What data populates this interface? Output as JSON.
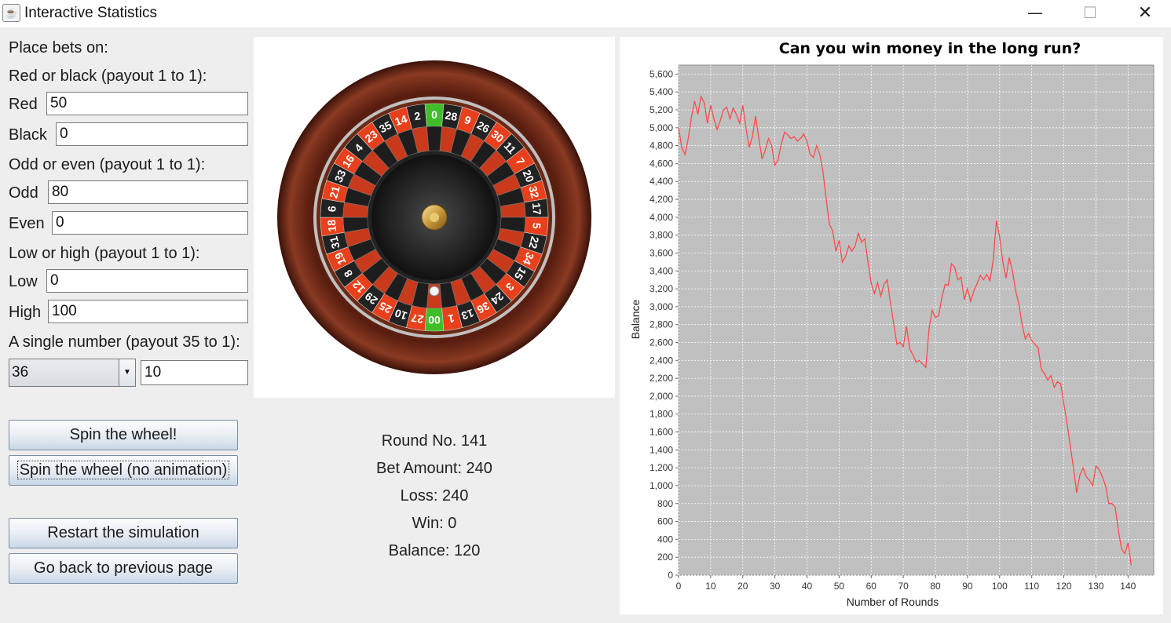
{
  "window": {
    "title": "Interactive Statistics",
    "min_glyph": "—",
    "max_glyph": "☐",
    "close_glyph": "✕"
  },
  "bets": {
    "header": "Place bets on:",
    "red_black_label": "Red or black (payout 1 to 1):",
    "red_label": "Red",
    "red_value": "50",
    "black_label": "Black",
    "black_value": "0",
    "odd_even_label": "Odd or even (payout 1 to 1):",
    "odd_label": "Odd",
    "odd_value": "80",
    "even_label": "Even",
    "even_value": "0",
    "low_high_label": "Low or high (payout 1 to 1):",
    "low_label": "Low",
    "low_value": "0",
    "high_label": "High",
    "high_value": "100",
    "single_label": "A single number (payout 35 to 1):",
    "single_number": "36",
    "single_value": "10"
  },
  "buttons": {
    "spin": "Spin the wheel!",
    "spin_no_anim": "Spin the wheel (no animation)",
    "restart": "Restart the simulation",
    "back": "Go back to previous page"
  },
  "wheel": {
    "numbers": [
      "0",
      "28",
      "9",
      "26",
      "30",
      "11",
      "7",
      "20",
      "32",
      "17",
      "5",
      "22",
      "34",
      "15",
      "3",
      "24",
      "36",
      "13",
      "1",
      "00",
      "27",
      "10",
      "25",
      "29",
      "12",
      "8",
      "19",
      "31",
      "18",
      "6",
      "21",
      "33",
      "16",
      "4",
      "23",
      "35",
      "14",
      "2"
    ],
    "colors": {
      "red": "#e8401c",
      "black": "#222222",
      "green": "#3fbe2a"
    }
  },
  "stats": {
    "round": "Round No. 141",
    "bet": "Bet Amount: 240",
    "loss": "Loss: 240",
    "win": "Win: 0",
    "balance": "Balance: 120"
  },
  "chart_data": {
    "type": "line",
    "title": "Can you win money in the long run?",
    "xlabel": "Number of Rounds",
    "ylabel": "Balance",
    "xlim": [
      0,
      148
    ],
    "ylim": [
      0,
      5700
    ],
    "xticks": [
      0,
      10,
      20,
      30,
      40,
      50,
      60,
      70,
      80,
      90,
      100,
      110,
      120,
      130,
      140
    ],
    "yticks": [
      0,
      200,
      400,
      600,
      800,
      1000,
      1200,
      1400,
      1600,
      1800,
      2000,
      2200,
      2400,
      2600,
      2800,
      3000,
      3200,
      3400,
      3600,
      3800,
      4000,
      4200,
      4400,
      4600,
      4800,
      5000,
      5200,
      5400,
      5600
    ],
    "grid": true,
    "background": "#c0c0c0",
    "line_color": "#ff4a4a",
    "series": [
      {
        "x": [
          0,
          1,
          2,
          3,
          4,
          5,
          6,
          7,
          8,
          9,
          10,
          11,
          12,
          13,
          14,
          15,
          16,
          17,
          18,
          19,
          20,
          21,
          22,
          23,
          24,
          25,
          26,
          27,
          28,
          29,
          30,
          31,
          32,
          33,
          34,
          35,
          36,
          37,
          38,
          39,
          40,
          41,
          42,
          43,
          44,
          45,
          46,
          47,
          48,
          49,
          50,
          51,
          52,
          53,
          54,
          55,
          56,
          57,
          58,
          59,
          60,
          61,
          62,
          63,
          64,
          65,
          66,
          67,
          68,
          69,
          70,
          71,
          72,
          73,
          74,
          75,
          76,
          77,
          78,
          79,
          80,
          81,
          82,
          83,
          84,
          85,
          86,
          87,
          88,
          89,
          90,
          91,
          92,
          93,
          94,
          95,
          96,
          97,
          98,
          99,
          100,
          101,
          102,
          103,
          104,
          105,
          106,
          107,
          108,
          109,
          110,
          111,
          112,
          113,
          114,
          115,
          116,
          117,
          118,
          119,
          120,
          121,
          122,
          123,
          124,
          125,
          126,
          127,
          128,
          129,
          130,
          131,
          132,
          133,
          134,
          135,
          136,
          137,
          138,
          139,
          140,
          141
        ],
        "values": [
          5000,
          4780,
          4700,
          4880,
          5120,
          5300,
          5150,
          5350,
          5280,
          5050,
          5250,
          5100,
          4980,
          5080,
          5200,
          5230,
          5100,
          5220,
          5150,
          5050,
          5250,
          5000,
          4780,
          4900,
          5130,
          4880,
          4650,
          4750,
          4880,
          4800,
          4580,
          4640,
          4820,
          4950,
          4920,
          4880,
          4900,
          4850,
          4880,
          4930,
          4850,
          4700,
          4670,
          4800,
          4700,
          4500,
          4200,
          3920,
          3850,
          3620,
          3740,
          3500,
          3560,
          3680,
          3620,
          3680,
          3820,
          3720,
          3760,
          3500,
          3260,
          3150,
          3270,
          3120,
          3250,
          3300,
          3040,
          2810,
          2580,
          2600,
          2550,
          2780,
          2530,
          2460,
          2380,
          2400,
          2360,
          2320,
          2750,
          2960,
          2880,
          2900,
          3100,
          3250,
          3240,
          3480,
          3440,
          3300,
          3330,
          3080,
          3200,
          3060,
          3180,
          3260,
          3350,
          3300,
          3360,
          3290,
          3520,
          3960,
          3780,
          3500,
          3320,
          3550,
          3400,
          3180,
          3030,
          2800,
          2640,
          2700,
          2620,
          2580,
          2540,
          2300,
          2250,
          2180,
          2230,
          2100,
          2160,
          2140,
          1920,
          1700,
          1450,
          1200,
          920,
          1120,
          1200,
          1100,
          1060,
          1000,
          1220,
          1180,
          1100,
          1000,
          800,
          800,
          760,
          500,
          290,
          240,
          360,
          110
        ]
      }
    ]
  }
}
